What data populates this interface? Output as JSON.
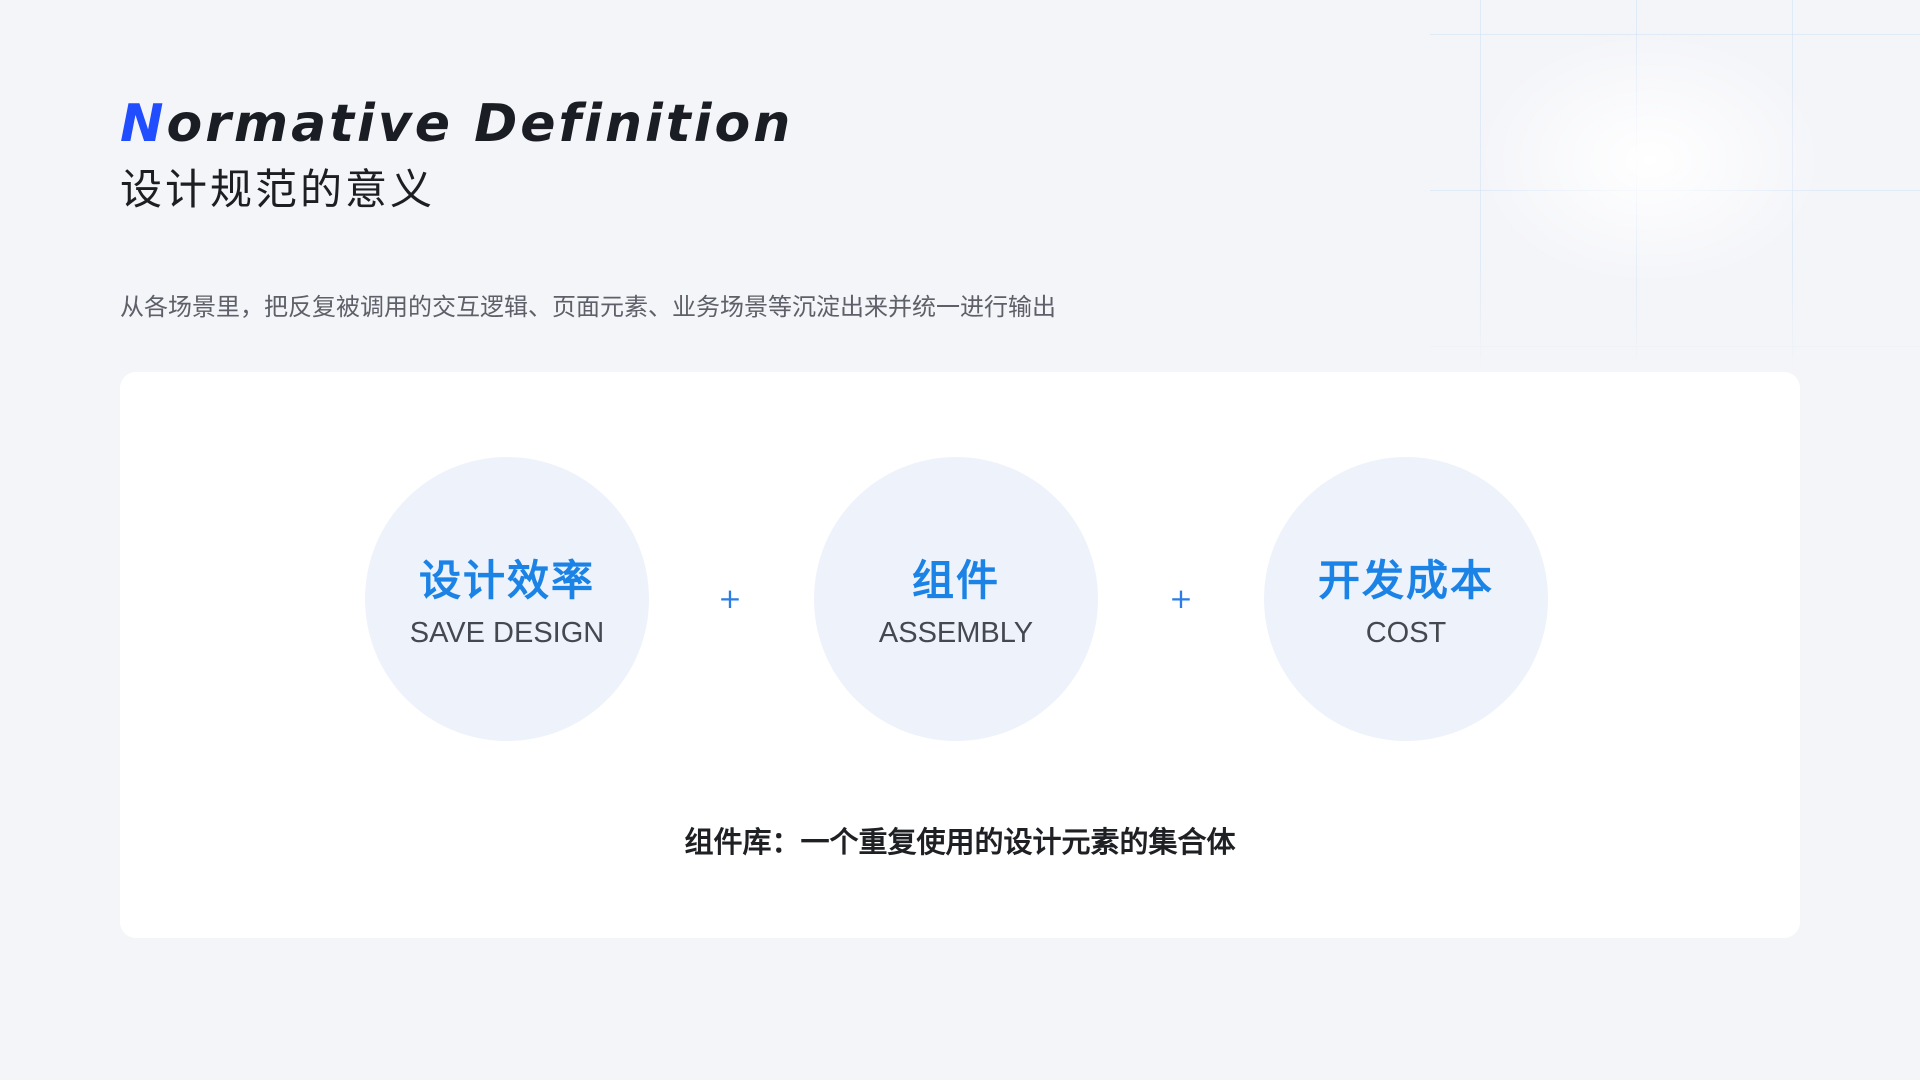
{
  "header": {
    "title_en_first": "N",
    "title_en_rest": "ormative Definition",
    "title_cn": "设计规范的意义"
  },
  "description": "从各场景里，把反复被调用的交互逻辑、页面元素、业务场景等沉淀出来并统一进行输出",
  "card": {
    "items": [
      {
        "title": "设计效率",
        "subtitle": "SAVE DESIGN"
      },
      {
        "title": "组件",
        "subtitle": "ASSEMBLY"
      },
      {
        "title": "开发成本",
        "subtitle": "COST"
      }
    ],
    "operator": "+",
    "summary": "组件库：一个重复使用的设计元素的集合体"
  },
  "colors": {
    "accent": "#1f4dff",
    "highlight": "#1b82e6",
    "circle_bg": "#eef2fb",
    "page_bg": "#f4f5f9"
  }
}
